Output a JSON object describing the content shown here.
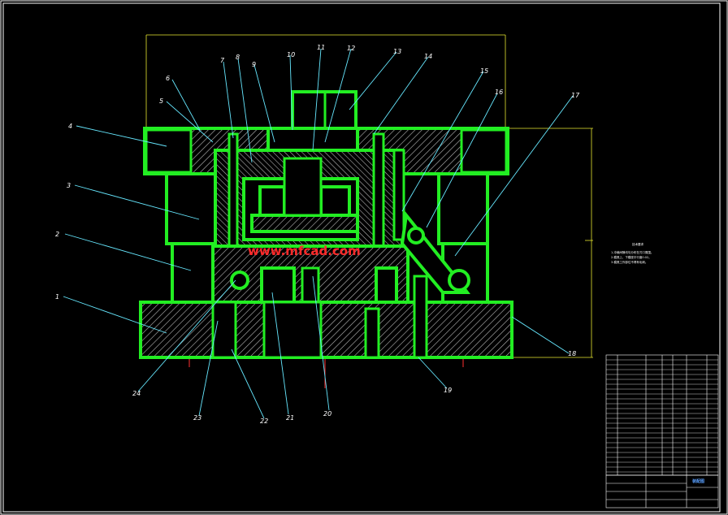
{
  "drawing": {
    "part_numbers": [
      "1",
      "2",
      "3",
      "4",
      "5",
      "6",
      "7",
      "8",
      "9",
      "10",
      "11",
      "12",
      "13",
      "14",
      "15",
      "16",
      "17",
      "18",
      "19",
      "20",
      "21",
      "22",
      "23",
      "24"
    ],
    "watermark": "www.mfcad.com",
    "notes_title": "技术要求",
    "notes": [
      "1.冲裁间隙均匀分布在刃口周围。",
      "2.模具上、下模座平行度0.02。",
      "3.模具工作部位不得有毛刺。"
    ],
    "title_block_name": "装配图",
    "colors": {
      "outline": "#22ee22",
      "hatch": "#cccccc",
      "dimension": "#e8e830",
      "centerline": "#ff3030",
      "leader": "#66e8ff",
      "titleblock": "#ffffff"
    }
  }
}
